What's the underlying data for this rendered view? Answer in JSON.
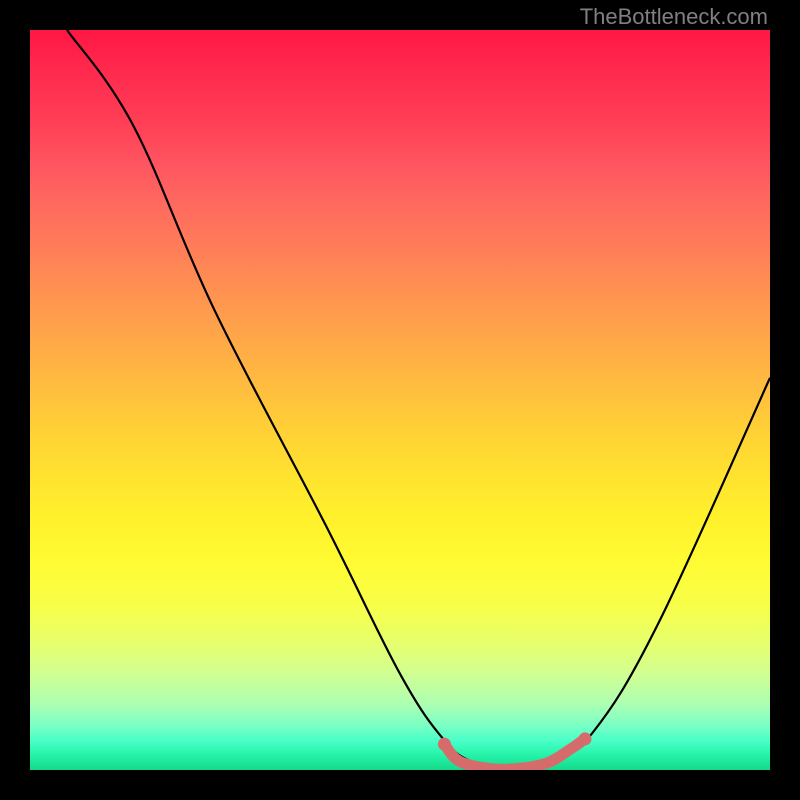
{
  "watermark": "TheBottleneck.com",
  "chart_data": {
    "type": "line",
    "title": "",
    "xlabel": "",
    "ylabel": "",
    "xlim": [
      0,
      100
    ],
    "ylim": [
      0,
      100
    ],
    "series": [
      {
        "name": "bottleneck-curve",
        "color": "#000000",
        "points": [
          {
            "x": 5,
            "y": 100
          },
          {
            "x": 14,
            "y": 87
          },
          {
            "x": 25,
            "y": 62
          },
          {
            "x": 40,
            "y": 33
          },
          {
            "x": 50,
            "y": 13
          },
          {
            "x": 56,
            "y": 4
          },
          {
            "x": 60,
            "y": 1
          },
          {
            "x": 65,
            "y": 0
          },
          {
            "x": 70,
            "y": 1
          },
          {
            "x": 76,
            "y": 5
          },
          {
            "x": 85,
            "y": 20
          },
          {
            "x": 100,
            "y": 53
          }
        ]
      },
      {
        "name": "valley-highlight",
        "color": "#d66b6b",
        "points": [
          {
            "x": 56,
            "y": 3.5
          },
          {
            "x": 58,
            "y": 1.2
          },
          {
            "x": 62,
            "y": 0.2
          },
          {
            "x": 66,
            "y": 0.2
          },
          {
            "x": 70,
            "y": 1.0
          },
          {
            "x": 73,
            "y": 2.8
          },
          {
            "x": 75,
            "y": 4.2
          }
        ]
      }
    ]
  },
  "colors": {
    "background": "#000000",
    "curve": "#000000",
    "highlight": "#d66b6b",
    "watermark": "#808080"
  }
}
